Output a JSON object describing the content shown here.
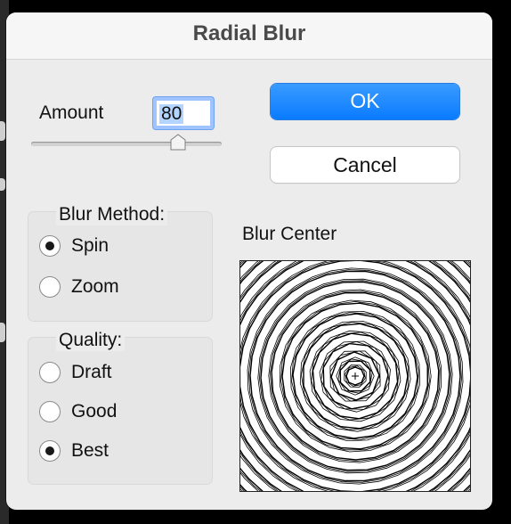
{
  "dialog": {
    "title": "Radial Blur"
  },
  "amount": {
    "label": "Amount",
    "value": "80",
    "slider_fraction": 0.8
  },
  "buttons": {
    "ok": "OK",
    "cancel": "Cancel"
  },
  "blur_method": {
    "legend": "Blur Method:",
    "options": [
      {
        "label": "Spin",
        "selected": true
      },
      {
        "label": "Zoom",
        "selected": false
      }
    ]
  },
  "quality": {
    "legend": "Quality:",
    "options": [
      {
        "label": "Draft",
        "selected": false
      },
      {
        "label": "Good",
        "selected": false
      },
      {
        "label": "Best",
        "selected": true
      }
    ]
  },
  "blur_center": {
    "label": "Blur Center"
  },
  "colors": {
    "accent": "#0a7bff",
    "dialog_bg": "#ececec"
  },
  "icons": [
    "slider-thumb-icon",
    "crosshair-icon"
  ]
}
